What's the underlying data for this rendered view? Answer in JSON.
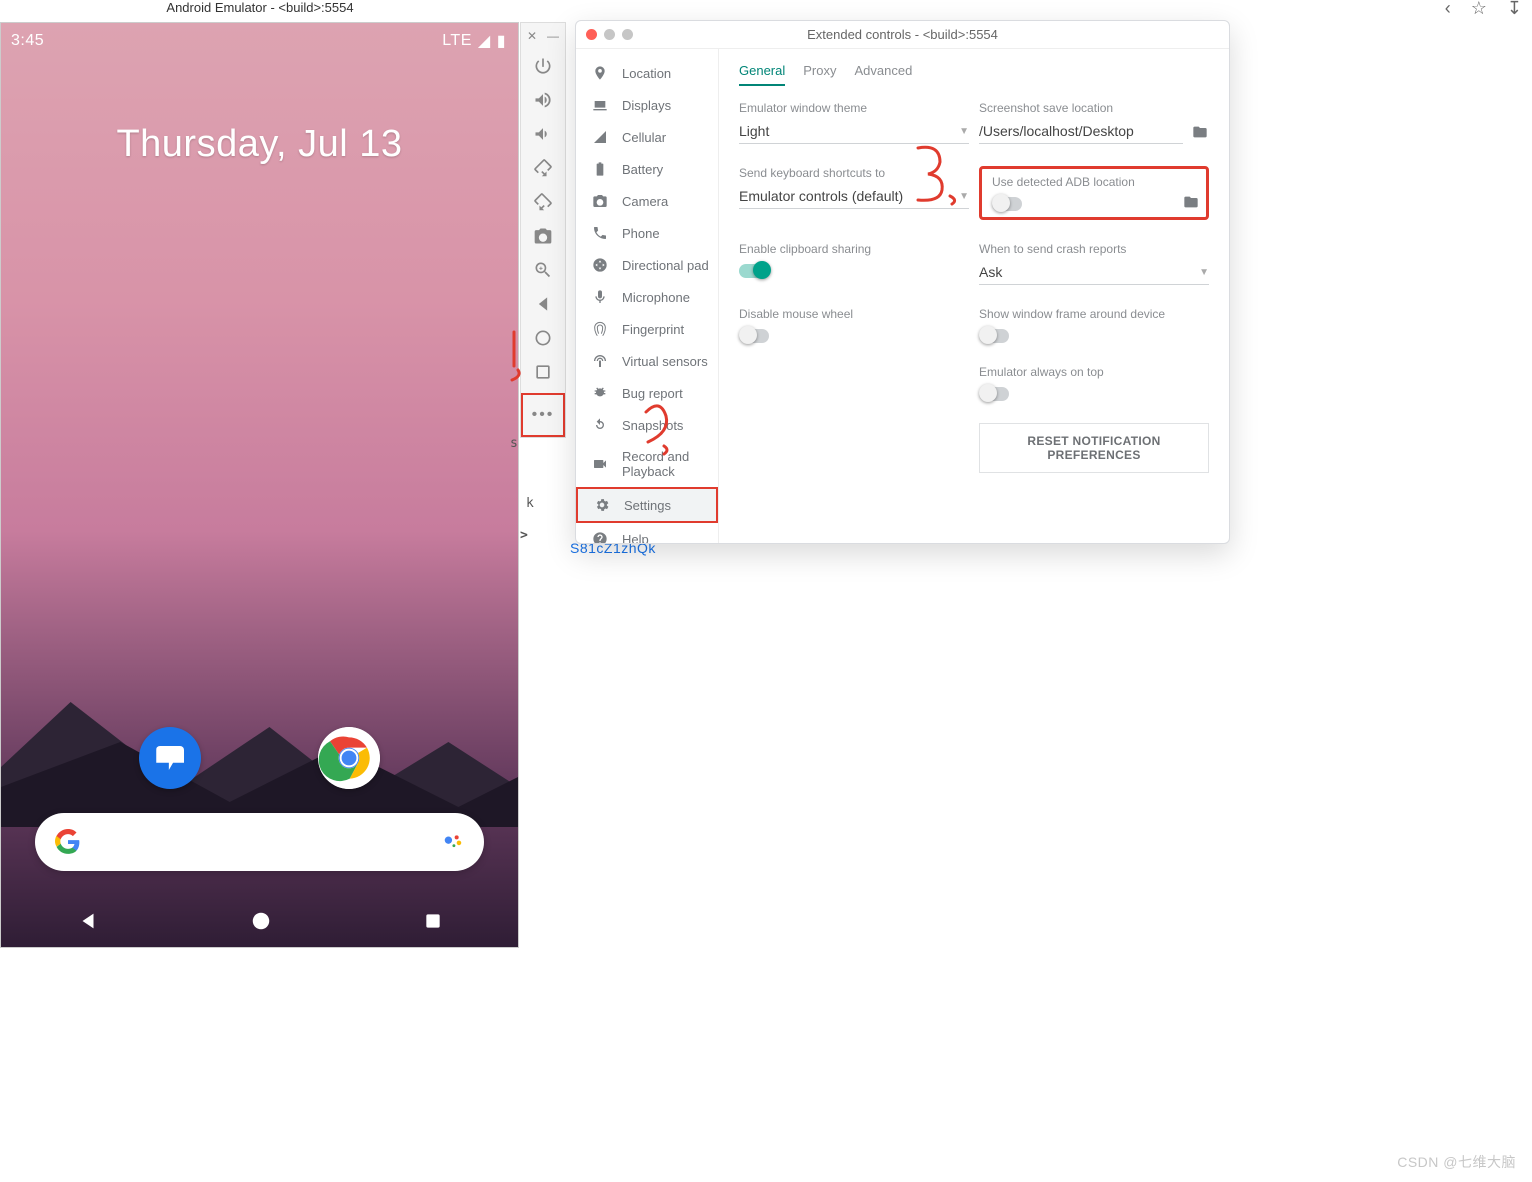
{
  "emulator": {
    "title": "Android Emulator - <build>:5554",
    "status_time": "3:45",
    "status_net": "LTE",
    "date_label": "Thursday, Jul 13",
    "apps": [
      "Messages",
      "Chrome"
    ],
    "search_placeholder": ""
  },
  "side_toolbar": [
    "power-icon",
    "volume-up-icon",
    "volume-down-icon",
    "rotate-left-icon",
    "rotate-right-icon",
    "camera-icon",
    "zoom-in-icon",
    "back-icon",
    "home-icon",
    "overview-icon"
  ],
  "ext": {
    "title": "Extended controls - <build>:5554",
    "nav": [
      {
        "icon": "pin",
        "label": "Location"
      },
      {
        "icon": "laptop",
        "label": "Displays"
      },
      {
        "icon": "signal",
        "label": "Cellular"
      },
      {
        "icon": "battery",
        "label": "Battery"
      },
      {
        "icon": "camera",
        "label": "Camera"
      },
      {
        "icon": "phone",
        "label": "Phone"
      },
      {
        "icon": "dpad",
        "label": "Directional pad"
      },
      {
        "icon": "mic",
        "label": "Microphone"
      },
      {
        "icon": "finger",
        "label": "Fingerprint"
      },
      {
        "icon": "sensors",
        "label": "Virtual sensors"
      },
      {
        "icon": "bug",
        "label": "Bug report"
      },
      {
        "icon": "refresh",
        "label": "Snapshots"
      },
      {
        "icon": "video",
        "label": "Record and Playback"
      },
      {
        "icon": "gear",
        "label": "Settings",
        "selected": true
      },
      {
        "icon": "help",
        "label": "Help"
      }
    ],
    "tabs": [
      "General",
      "Proxy",
      "Advanced"
    ],
    "active_tab": "General",
    "fields": {
      "theme": {
        "label": "Emulator window theme",
        "value": "Light"
      },
      "screenshot": {
        "label": "Screenshot save location",
        "value": "/Users/localhost/Desktop"
      },
      "shortcuts": {
        "label": "Send keyboard shortcuts to",
        "value": "Emulator controls (default)"
      },
      "adb": {
        "label": "Use detected ADB location",
        "value_on": false
      },
      "clipboard": {
        "label": "Enable clipboard sharing",
        "value_on": true
      },
      "crash": {
        "label": "When to send crash reports",
        "value": "Ask"
      },
      "mouse": {
        "label": "Disable mouse wheel",
        "value_on": false
      },
      "frame": {
        "label": "Show window frame around device",
        "value_on": false
      },
      "ontop": {
        "label": "Emulator always on top",
        "value_on": false
      }
    },
    "reset_label": "RESET NOTIFICATION PREFERENCES"
  },
  "gap_text": "S81cZ1zhQk",
  "annotations": {
    "1": "1.",
    "2": "2.",
    "3": "3."
  },
  "watermark": "CSDN @七维大脑"
}
